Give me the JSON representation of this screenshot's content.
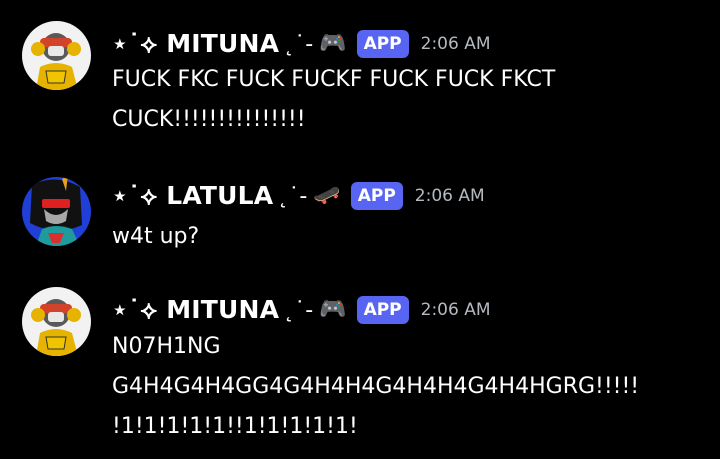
{
  "messages": [
    {
      "author": {
        "prefix": "⋆˙⟡",
        "name": "MITUNA",
        "suffix": "˛˙-",
        "emoji": "🎮"
      },
      "badge": "APP",
      "time": "2:06 AM",
      "lines": [
        "FUCK FKC FUCK FUCKF FUCK FUCK FKCT",
        "CUCK!!!!!!!!!!!!!!!"
      ]
    },
    {
      "author": {
        "prefix": "⋆˙⟡",
        "name": "LATULA",
        "suffix": "˛˙-",
        "emoji": "🛹"
      },
      "badge": "APP",
      "time": "2:06 AM",
      "lines": [
        "w4t up?"
      ]
    },
    {
      "author": {
        "prefix": "⋆˙⟡",
        "name": "MITUNA",
        "suffix": "˛˙-",
        "emoji": "🎮"
      },
      "badge": "APP",
      "time": "2:06 AM",
      "lines": [
        "N07H1NG",
        "G4H4G4H4GG4G4H4H4G4H4H4G4H4HGRG!!!!!",
        "!1!1!1!1!1!!1!1!1!1!1!"
      ]
    }
  ],
  "colors": {
    "background": "#000000",
    "badge": "#5865f2",
    "timestamp": "#b5bac1",
    "text": "#ffffff"
  }
}
